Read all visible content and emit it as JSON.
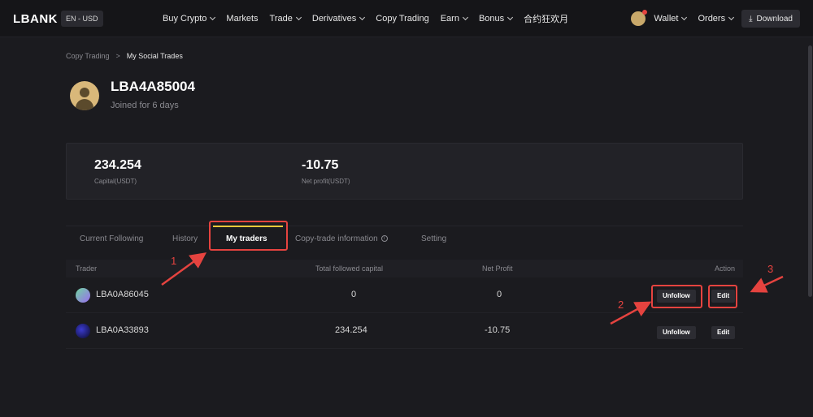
{
  "header": {
    "logo": "LBANK",
    "lang": "EN - USD",
    "nav": [
      "Buy Crypto",
      "Markets",
      "Trade",
      "Derivatives",
      "Copy Trading",
      "Earn",
      "Bonus",
      "合约狂欢月"
    ],
    "wallet": "Wallet",
    "orders": "Orders",
    "download": "Download"
  },
  "breadcrumb": {
    "parent": "Copy Trading",
    "separator": ">",
    "current": "My Social Trades"
  },
  "profile": {
    "username": "LBA4A85004",
    "joined": "Joined for 6 days"
  },
  "stats": [
    {
      "value": "234.254",
      "label": "Capital(USDT)"
    },
    {
      "value": "-10.75",
      "label": "Net profit(USDT)"
    }
  ],
  "tabs": [
    "Current Following",
    "History",
    "My traders",
    "Copy-trade information",
    "Setting"
  ],
  "table": {
    "headers": [
      "Trader",
      "Total followed capital",
      "Net Profit",
      "Action"
    ],
    "rows": [
      {
        "trader": "LBA0A86045",
        "capital": "0",
        "profit": "0",
        "unfollow": "Unfollow",
        "edit": "Edit"
      },
      {
        "trader": "LBA0A33893",
        "capital": "234.254",
        "profit": "-10.75",
        "unfollow": "Unfollow",
        "edit": "Edit"
      }
    ]
  },
  "annotations": [
    "1",
    "2",
    "3"
  ],
  "colors": {
    "accent_yellow": "#f0c93b",
    "annotation_red": "#e5433f",
    "background": "#1b1b1f"
  }
}
